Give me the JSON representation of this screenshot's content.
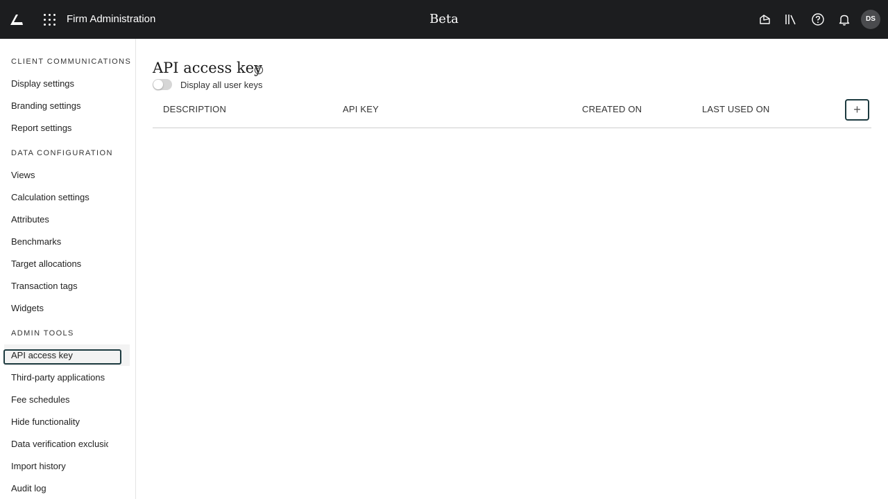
{
  "header": {
    "app_title": "Firm Administration",
    "environment_label": "Beta",
    "avatar_initials": "DS",
    "icons": [
      "logo-icon",
      "apps-grid-icon",
      "chart-icon",
      "library-icon",
      "help-icon",
      "bell-icon"
    ]
  },
  "sidebar": {
    "sections": [
      {
        "heading": "CLIENT COMMUNICATIONS",
        "items": [
          "Display settings",
          "Branding settings",
          "Report settings"
        ]
      },
      {
        "heading": "DATA CONFIGURATION",
        "items": [
          "Views",
          "Calculation settings",
          "Attributes",
          "Benchmarks",
          "Target allocations",
          "Transaction tags",
          "Widgets"
        ]
      },
      {
        "heading": "ADMIN TOOLS",
        "items": [
          "API access key",
          "Third-party applications",
          "Fee schedules",
          "Hide functionality",
          "Data verification exclusic",
          "Import history",
          "Audit log"
        ]
      }
    ],
    "active_item": "API access key"
  },
  "main": {
    "title": "API access key",
    "toggle": {
      "label": "Display all user keys",
      "on": false
    },
    "table": {
      "columns": [
        "DESCRIPTION",
        "API KEY",
        "CREATED ON",
        "LAST USED ON"
      ],
      "add_button_label": "+",
      "rows": []
    }
  }
}
